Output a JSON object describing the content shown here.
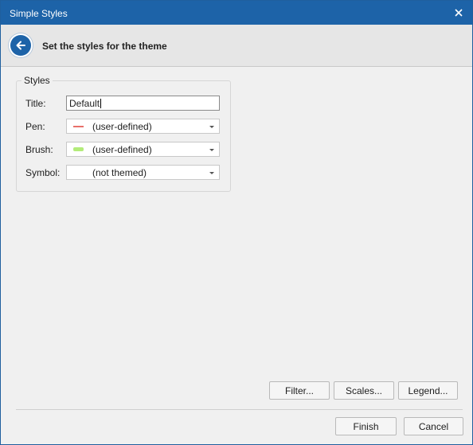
{
  "window": {
    "title": "Simple Styles"
  },
  "header": {
    "step_title": "Set the styles for the theme"
  },
  "styles_group": {
    "legend": "Styles",
    "title": {
      "label": "Title:",
      "value": "Default"
    },
    "pen": {
      "label": "Pen:",
      "value": "(user-defined)",
      "swatch_color": "#e8706a"
    },
    "brush": {
      "label": "Brush:",
      "value": "(user-defined)",
      "swatch_color": "#b3ec7a"
    },
    "symbol": {
      "label": "Symbol:",
      "value": "(not themed)"
    }
  },
  "buttons": {
    "filter": "Filter...",
    "scales": "Scales...",
    "legend": "Legend...",
    "finish": "Finish",
    "cancel": "Cancel"
  },
  "colors": {
    "titlebar": "#1d63a8",
    "window_bg": "#f0f0f0",
    "header_bg": "#e6e6e6"
  },
  "icons": [
    "close-icon",
    "back-arrow-icon",
    "chevron-down-icon"
  ]
}
